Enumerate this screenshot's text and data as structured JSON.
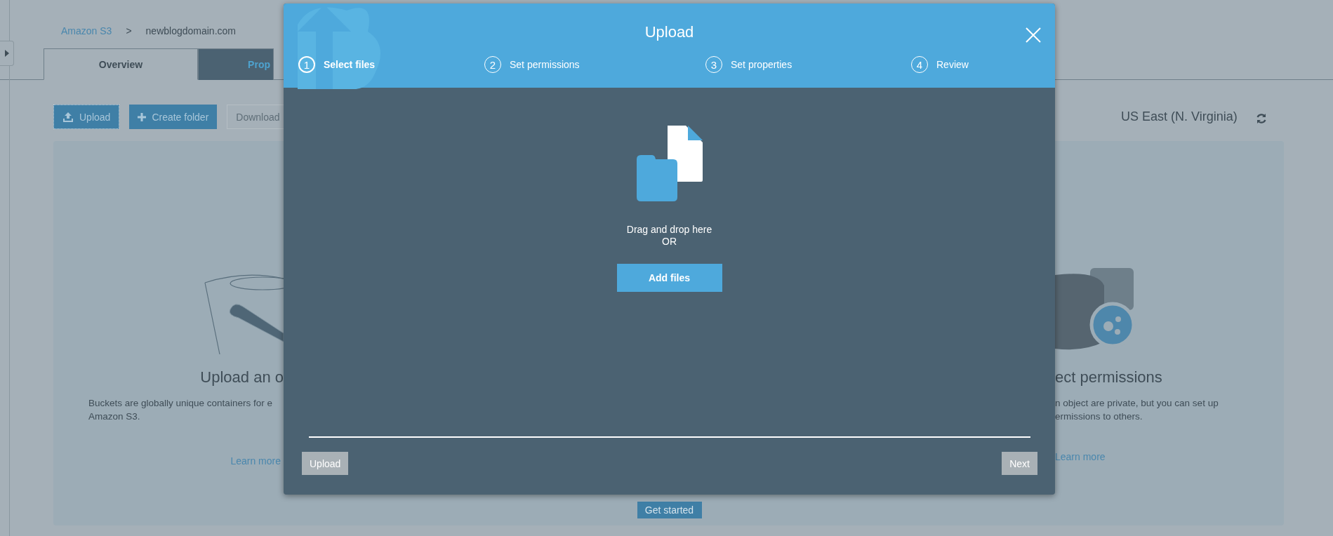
{
  "breadcrumb": {
    "root": "Amazon S3",
    "separator": ">",
    "current": "newblogdomain.com"
  },
  "tabs": [
    {
      "label": "Overview",
      "selected": true
    },
    {
      "label": "Prop",
      "selected": false
    }
  ],
  "toolbar": [
    {
      "label": "Upload",
      "kind": "focused"
    },
    {
      "label": "Create folder",
      "kind": "primary"
    },
    {
      "label": "Download",
      "kind": "disabled"
    }
  ],
  "region": "US East (N. Virginia)",
  "cards": {
    "left": {
      "title": "Upload an o",
      "lines": [
        "Buckets are globally unique containers for e",
        "Amazon S3."
      ],
      "link": "Learn more"
    },
    "right": {
      "title": "ect permissions",
      "lines": [
        "n object are private, but you can set up",
        "ermissions to others."
      ],
      "link": "Learn more"
    },
    "action": "Get started"
  },
  "modal": {
    "title": "Upload",
    "steps": [
      {
        "number": "1",
        "label": "Select files",
        "selected": true
      },
      {
        "number": "2",
        "label": "Set permissions",
        "selected": false
      },
      {
        "number": "3",
        "label": "Set properties",
        "selected": false
      },
      {
        "number": "4",
        "label": "Review",
        "selected": false
      }
    ],
    "drop_text": "Drag and drop here",
    "or_text": "OR",
    "add_button": "Add files",
    "footer": {
      "upload": "Upload",
      "next": "Next"
    }
  }
}
